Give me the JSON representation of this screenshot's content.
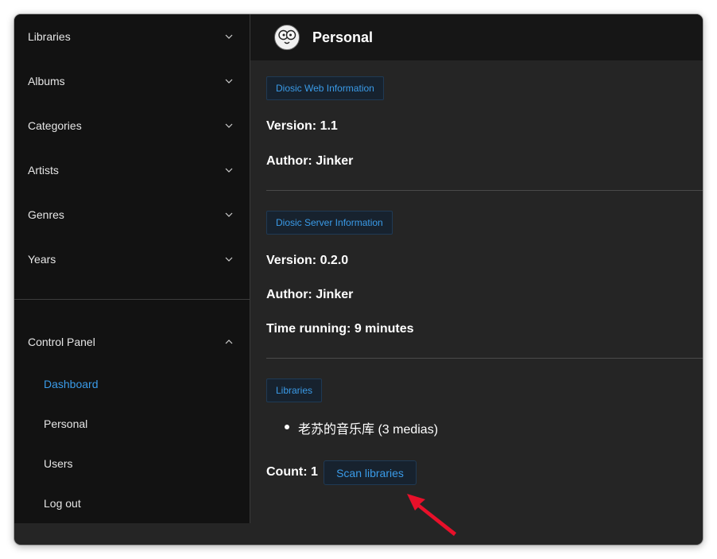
{
  "sidebar": {
    "items": [
      {
        "label": "Libraries",
        "icon": "chevron-down-icon"
      },
      {
        "label": "Albums",
        "icon": "chevron-down-icon"
      },
      {
        "label": "Categories",
        "icon": "chevron-down-icon"
      },
      {
        "label": "Artists",
        "icon": "chevron-down-icon"
      },
      {
        "label": "Genres",
        "icon": "chevron-down-icon"
      },
      {
        "label": "Years",
        "icon": "chevron-down-icon"
      }
    ],
    "control_panel": {
      "label": "Control Panel",
      "icon": "chevron-up-icon",
      "subitems": [
        {
          "label": "Dashboard",
          "active": true
        },
        {
          "label": "Personal"
        },
        {
          "label": "Users"
        },
        {
          "label": "Log out"
        }
      ]
    }
  },
  "header": {
    "title": "Personal",
    "avatar_icon": "user-avatar-icon"
  },
  "web_info": {
    "tag": "Diosic Web Information",
    "version": "Version: 1.1",
    "author": "Author: Jinker"
  },
  "server_info": {
    "tag": "Diosic Server Information",
    "version": "Version: 0.2.0",
    "author": "Author: Jinker",
    "time_running": "Time running: 9 minutes"
  },
  "libraries": {
    "tag": "Libraries",
    "items": [
      "老苏的音乐库 (3 medias)"
    ],
    "count": "Count: 1",
    "scan_label": "Scan libraries"
  },
  "colors": {
    "accent": "#3a9be8",
    "sidebar_bg": "#121212",
    "main_bg": "#252525",
    "annotation_arrow": "#e8102a"
  }
}
